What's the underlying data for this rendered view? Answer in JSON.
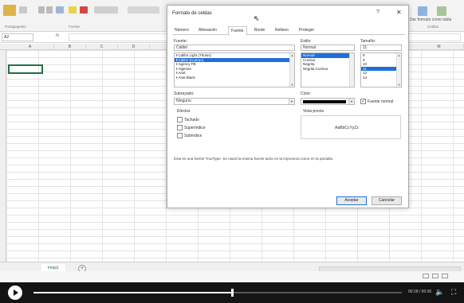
{
  "excel": {
    "ribbon_right_label": "Dar formato como tabla",
    "ribbon_group_font": "Fuente",
    "ribbon_group_clipboard": "Portapapeles",
    "ribbon_group_cells": "Celdas",
    "namebox": "A2",
    "fx": "fx",
    "columns": [
      "A",
      "B",
      "C",
      "D",
      "M"
    ],
    "sheet_tab": "Hoja1",
    "add_sheet": "+"
  },
  "dialog": {
    "title": "Formato de celdas",
    "help": "?",
    "close": "✕",
    "tabs": [
      "Número",
      "Alineación",
      "Fuente",
      "Borde",
      "Relleno",
      "Proteger"
    ],
    "font_label": "Fuente:",
    "font_value": "Calibri",
    "font_list": [
      "Calibri Light (Títulos)",
      "Calibri (Cuerpo)",
      "Agency FB",
      "Algerian",
      "Arial",
      "Arial Black"
    ],
    "font_selected_index": 1,
    "style_label": "Estilo:",
    "style_value": "Normal",
    "style_list": [
      "Normal",
      "Cursiva",
      "Negrita",
      "Negrita Cursiva"
    ],
    "style_selected_index": 0,
    "size_label": "Tamaño:",
    "size_value": "11",
    "size_list": [
      "8",
      "9",
      "10",
      "11",
      "12",
      "14"
    ],
    "size_selected_index": 3,
    "underline_label": "Subrayado:",
    "underline_value": "Ninguno",
    "color_label": "Color:",
    "normal_font_label": "Fuente normal",
    "effects_label": "Efectos",
    "effect_strike": "Tachado",
    "effect_super": "Superíndice",
    "effect_sub": "Subíndice",
    "preview_label": "Vista previa",
    "preview_text": "AaBbCcYyZz",
    "footnote": "Ésta es una fuente TrueType. Se usará la misma fuente tanto en la impresora como en la pantalla.",
    "ok": "Aceptar",
    "cancel": "Cancelar"
  },
  "player": {
    "time": "00:18 / 00:36",
    "progress_fraction": 0.54
  },
  "colors": {
    "excel_green": "#217346",
    "selection_blue": "#1e6fd9",
    "player_bg": "#141414"
  }
}
